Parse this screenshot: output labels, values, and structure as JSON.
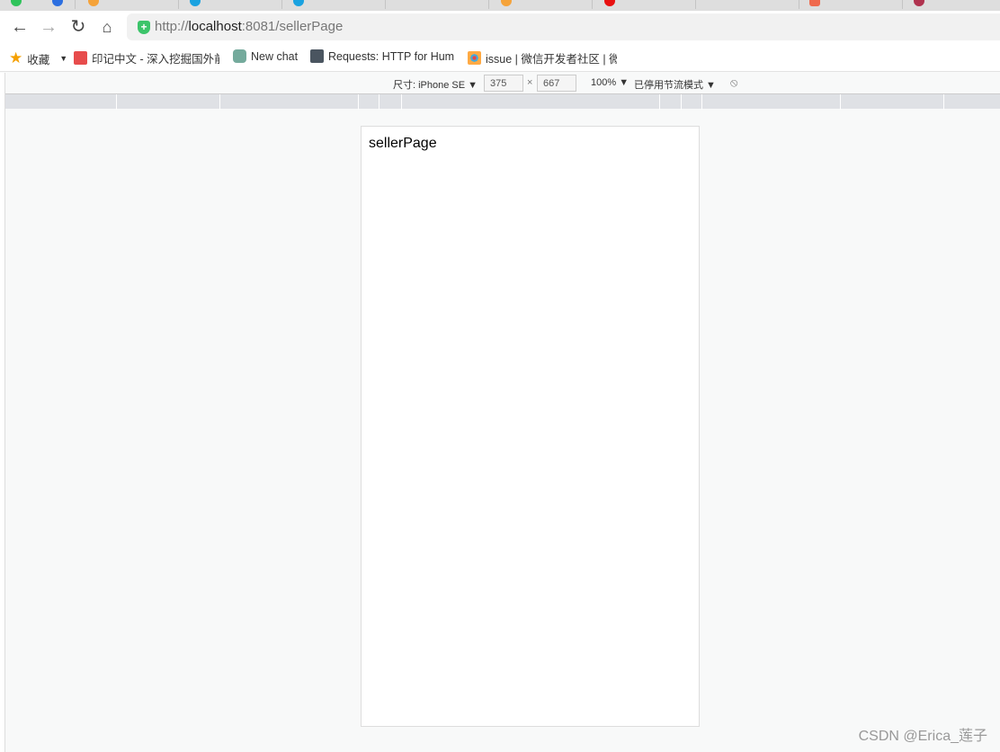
{
  "browser": {
    "url_prefix": "http://",
    "url_host": "localhost",
    "url_rest": ":8081/sellerPage",
    "bookmarks": [
      {
        "label": "收藏",
        "icon": "star-icon"
      },
      {
        "label": "印记中文 - 深入挖掘国外前",
        "icon": "yinji-icon"
      },
      {
        "label": "New chat",
        "icon": "openai-icon"
      },
      {
        "label": "Requests: HTTP for Hum",
        "icon": "requests-icon"
      },
      {
        "label": "issue | 微信开发者社区 | 微",
        "icon": "wechat-dev-icon"
      }
    ]
  },
  "devtools": {
    "device_label": "尺寸: iPhone SE ▼",
    "width": "375",
    "times": "×",
    "height": "667",
    "zoom": "100% ▼",
    "throttle": "已停用节流模式 ▼"
  },
  "page": {
    "text": "sellerPage"
  },
  "watermark": "CSDN @Erica_莲子"
}
